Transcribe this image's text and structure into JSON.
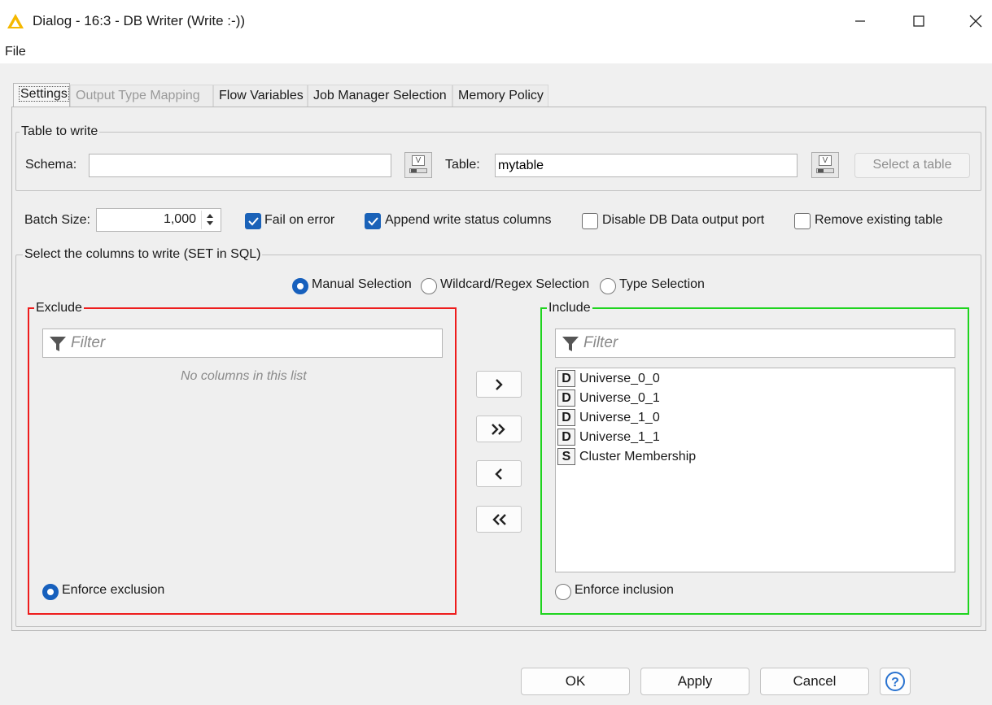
{
  "window": {
    "title": "Dialog - 16:3 - DB Writer (Write :-))",
    "app_icon": "warning-triangle-icon",
    "accent": "#f5b800"
  },
  "menu": {
    "file": "File"
  },
  "tabs": [
    {
      "label": "Settings",
      "state": "active"
    },
    {
      "label": "Output Type Mapping",
      "state": "disabled"
    },
    {
      "label": "Flow Variables",
      "state": "normal"
    },
    {
      "label": "Job Manager Selection",
      "state": "normal"
    },
    {
      "label": "Memory Policy",
      "state": "normal"
    }
  ],
  "table_to_write": {
    "legend": "Table to write",
    "schema_label": "Schema:",
    "schema_value": "",
    "table_label": "Table:",
    "table_value": "mytable",
    "select_table_button": "Select a table"
  },
  "options": {
    "batch_size_label": "Batch Size:",
    "batch_size_value": "1,000",
    "fail_on_error": {
      "label": "Fail on error",
      "checked": true
    },
    "append_status": {
      "label": "Append write status columns",
      "checked": true
    },
    "disable_output": {
      "label": "Disable DB Data output port",
      "checked": false
    },
    "remove_table": {
      "label": "Remove existing table",
      "checked": false
    }
  },
  "columns": {
    "legend": "Select the columns to write (SET in SQL)",
    "modes": [
      {
        "label": "Manual Selection",
        "selected": true
      },
      {
        "label": "Wildcard/Regex Selection",
        "selected": false
      },
      {
        "label": "Type Selection",
        "selected": false
      }
    ],
    "exclude": {
      "legend": "Exclude",
      "border_color": "#ee1c1c",
      "filter_placeholder": "Filter",
      "empty_text": "No columns in this list",
      "enforce_label": "Enforce exclusion",
      "enforce_selected": true
    },
    "include": {
      "legend": "Include",
      "border_color": "#1ed41e",
      "filter_placeholder": "Filter",
      "items": [
        {
          "type": "D",
          "name": "Universe_0_0"
        },
        {
          "type": "D",
          "name": "Universe_0_1"
        },
        {
          "type": "D",
          "name": "Universe_1_0"
        },
        {
          "type": "D",
          "name": "Universe_1_1"
        },
        {
          "type": "S",
          "name": "Cluster Membership"
        }
      ],
      "enforce_label": "Enforce inclusion",
      "enforce_selected": false
    },
    "move_buttons": [
      ">",
      "»",
      "<",
      "«"
    ]
  },
  "footer": {
    "ok": "OK",
    "apply": "Apply",
    "cancel": "Cancel",
    "help_icon": "help-icon"
  }
}
